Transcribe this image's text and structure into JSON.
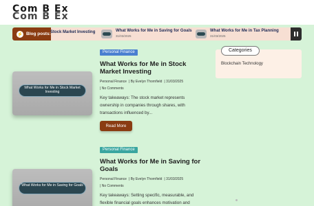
{
  "site": {
    "logo_line1": "Com B Ex",
    "logo_line2": "Com B Ex"
  },
  "ticker": {
    "label": "Blog posts:",
    "items": [
      {
        "title": "Stock Market Investing",
        "date": ""
      },
      {
        "title": "What Works for Me in Saving for Goals",
        "date": "31/03/2025"
      },
      {
        "title": "What Works for Me in Tax Planning",
        "date": "31/03/2025"
      }
    ]
  },
  "posts": [
    {
      "category": "Personal Finance",
      "title": "What Works for Me in Stock Market Investing",
      "image_text": "What Works for Me in Stock Market Investing",
      "meta_category": "Personal Finance",
      "author": "By Evelyn Thornfield",
      "date": "31/03/2025",
      "comments": "No Comments",
      "excerpt": "Key takeaways: The stock market represents ownership in companies through shares, with transactions influenced by...",
      "read_more": "Read More"
    },
    {
      "category": "Personal Finance",
      "title": "What Works for Me in Saving for Goals",
      "image_text": "What Works for Me in Saving for Goals",
      "meta_category": "Personal Finance",
      "author": "By Evelyn Thornfield",
      "date": "31/03/2025",
      "comments": "No Comments",
      "excerpt": "Key takeaways: Setting specific, measurable, and flexible financial goals enhances motivation and"
    }
  ],
  "sidebar": {
    "title": "Categories",
    "items": [
      "Blockchain Technology"
    ]
  },
  "colors": {
    "accent": "#8a3c12",
    "background": "#d6f3d8",
    "category_teal": "#3aa6a0",
    "category_blue": "#4a7fd0"
  }
}
